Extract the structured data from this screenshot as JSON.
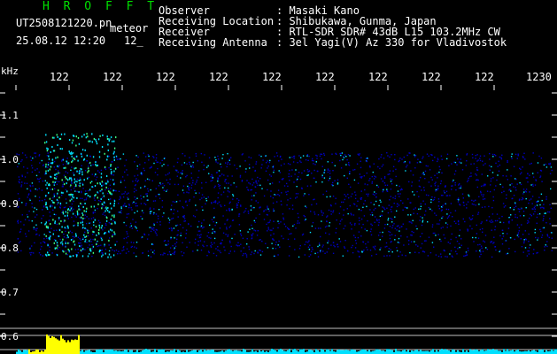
{
  "header": {
    "brand": "H R O F F T",
    "filename": "UT2508121220.pn",
    "tag": "meteor",
    "timestamp": "25.08.12 12:20",
    "timestamp_suffix": "12_",
    "info": [
      {
        "label": "Observer",
        "value": ": Masaki Kano"
      },
      {
        "label": "Receiving Location",
        "value": ": Shibukawa, Gunma, Japan"
      },
      {
        "label": "Receiver",
        "value": ": RTL-SDR SDR# 43dB L15 103.2MHz CW"
      },
      {
        "label": "Receiving Antenna",
        "value": ": 3el Yagi(V) Az 330 for Vladivostok"
      }
    ]
  },
  "axis": {
    "y_unit": "kHz",
    "y_ticks": [
      "1.1",
      "1.0",
      "0.9",
      "0.8",
      "0.7",
      "0.6"
    ],
    "x_ticks": [
      "122",
      "122",
      "122",
      "122",
      "122",
      "122",
      "122",
      "122",
      "122",
      "1230"
    ]
  },
  "colors": {
    "background": "#000000",
    "brand": "#00e000",
    "grid": "#ffffff",
    "spectrogram_low": "#0000c0",
    "spectrogram_high": "#00e0ff",
    "meteor": "#ffff00",
    "amplitude": "#00e0ff"
  }
}
